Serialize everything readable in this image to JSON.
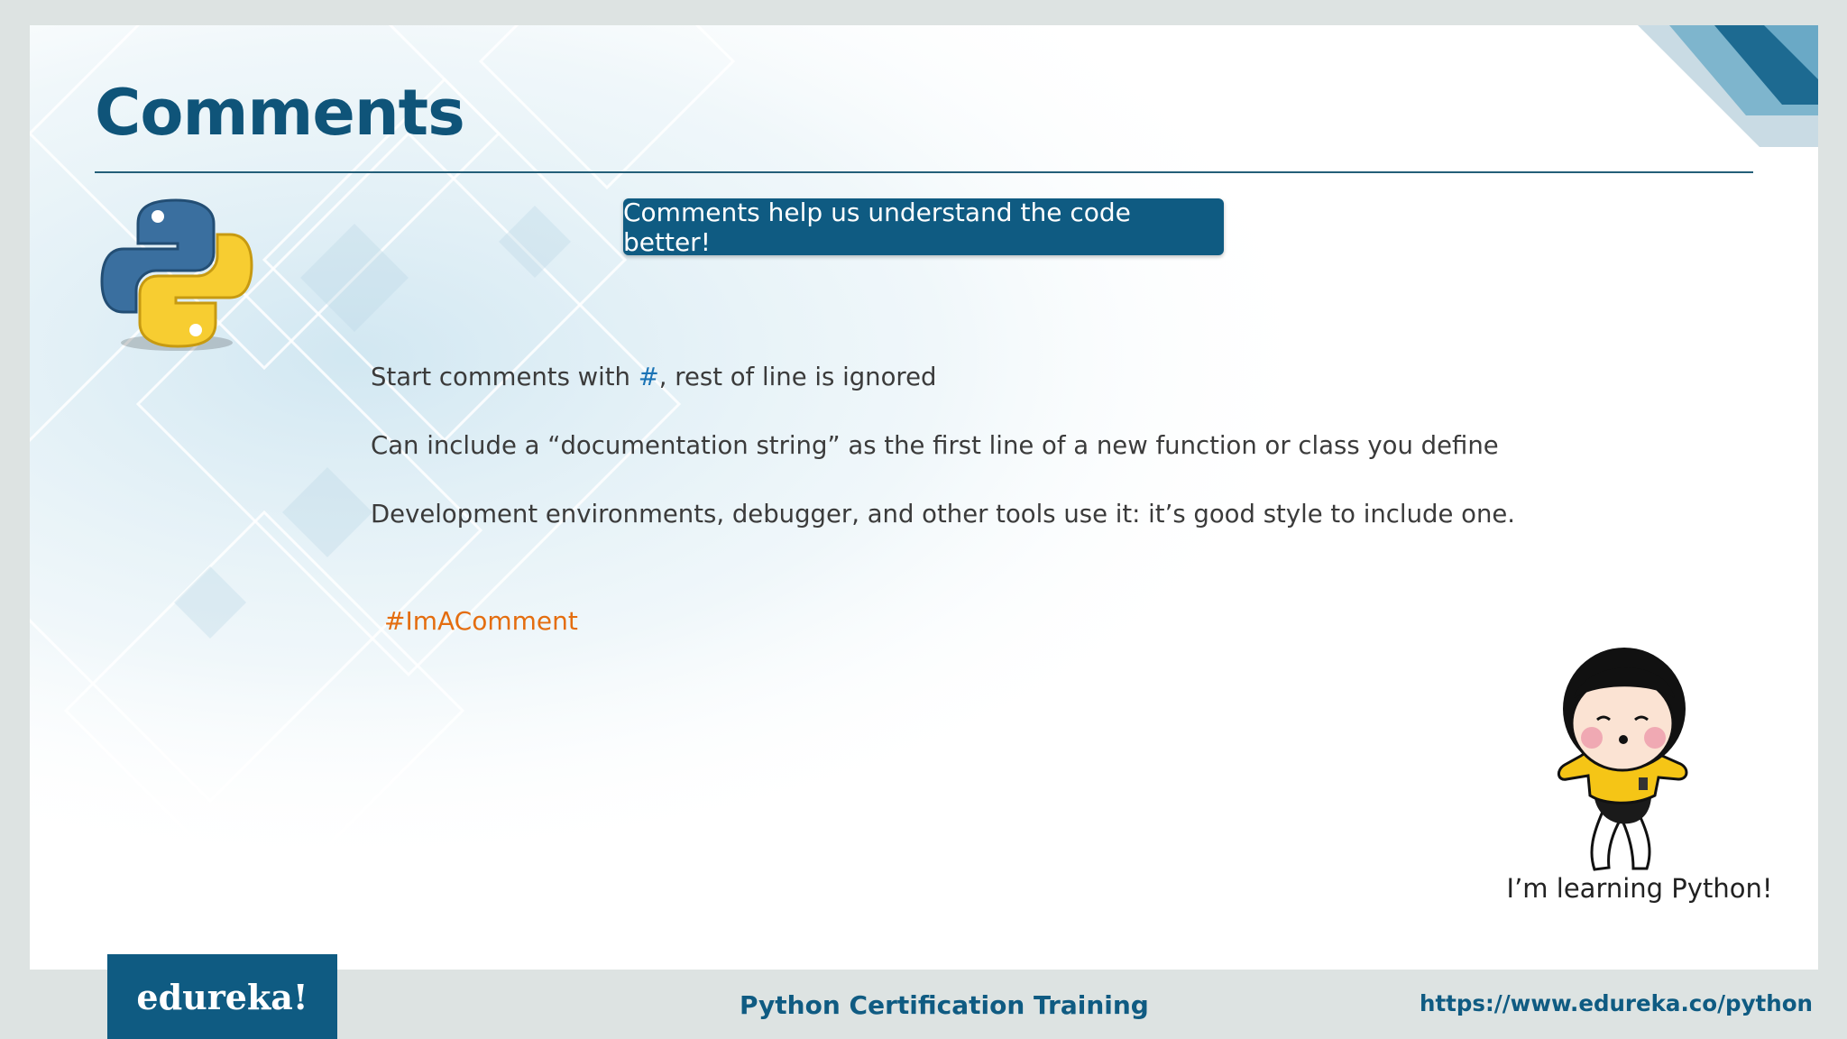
{
  "slide": {
    "title": "Comments",
    "callout": "Comments help us understand the code better!",
    "bullets": [
      {
        "before": "Start comments with ",
        "hash": "#",
        "after": ", rest of line is ignored"
      },
      {
        "text": "Can include a “documentation string” as the first line of a new function or class you define"
      },
      {
        "text": "Development environments, debugger, and other tools use it: it’s good style to include one."
      }
    ],
    "example_comment": "#ImAComment",
    "mascot_caption": "I’m learning Python!",
    "icons": [
      "python-logo-icon",
      "girl-mascot-icon"
    ]
  },
  "footer": {
    "logo_text": "edureka!",
    "course": "Python Certification Training",
    "url": "https://www.edureka.co/python"
  },
  "colors": {
    "title": "#0f5479",
    "callout_bg": "#0f5b82",
    "hash": "#1a73b5",
    "comment": "#e46d0f",
    "footer_accent": "#0f5b82"
  }
}
